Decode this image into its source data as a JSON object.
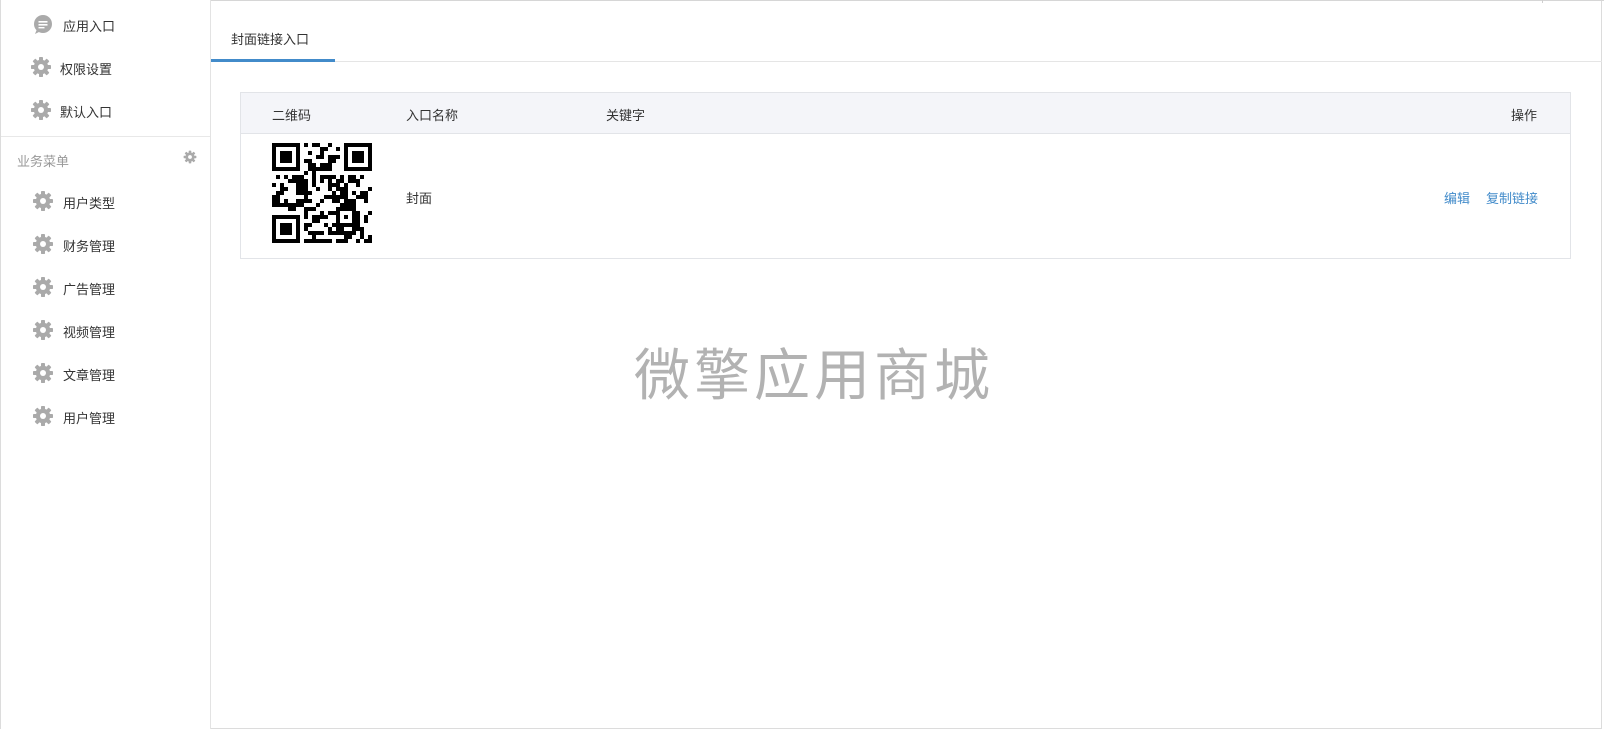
{
  "sidebar": {
    "items": [
      {
        "label": "应用入口",
        "icon": "comment-bubble-icon"
      },
      {
        "label": "权限设置",
        "icon": "gear-icon"
      },
      {
        "label": "默认入口",
        "icon": "gear-icon"
      }
    ],
    "group": {
      "title": "业务菜单",
      "settings_icon": "gear-icon",
      "items": [
        {
          "label": "用户类型",
          "icon": "gear-icon"
        },
        {
          "label": "财务管理",
          "icon": "gear-icon"
        },
        {
          "label": "广告管理",
          "icon": "gear-icon"
        },
        {
          "label": "视频管理",
          "icon": "gear-icon"
        },
        {
          "label": "文章管理",
          "icon": "gear-icon"
        },
        {
          "label": "用户管理",
          "icon": "gear-icon"
        }
      ]
    }
  },
  "tabs": [
    {
      "label": "封面链接入口",
      "active": true
    }
  ],
  "table": {
    "columns": {
      "qrcode": "二维码",
      "name": "入口名称",
      "keyword": "关键字",
      "actions": "操作"
    },
    "rows": [
      {
        "qrcode_icon": "qr-code-icon",
        "name": "封面",
        "keyword": "",
        "actions": {
          "edit": "编辑",
          "copy_link": "复制链接"
        }
      }
    ]
  },
  "watermark": "微擎应用商城",
  "colors": {
    "accent": "#428bca",
    "header_bg": "#f4f5f9",
    "icon_gray": "#aaaaaa",
    "muted_text": "#999999",
    "watermark": "#b2b2b2"
  }
}
